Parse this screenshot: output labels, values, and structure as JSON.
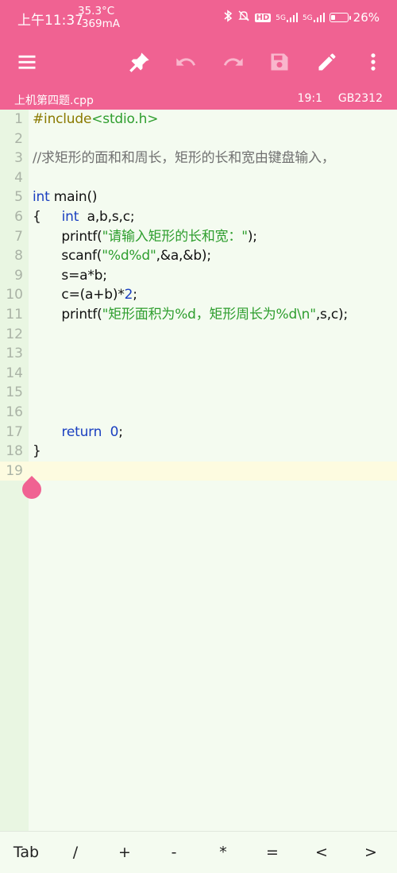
{
  "status_bar": {
    "time": "上午11:37",
    "temp": "35.3°C",
    "current": "-369mA",
    "net1": "5G",
    "net2": "5G",
    "hd": "HD",
    "battery_percent": "26%",
    "battery_level": 0.26
  },
  "toolbar": {
    "icons": [
      "menu-icon",
      "pin-icon",
      "undo-icon",
      "redo-icon",
      "save-icon",
      "edit-icon",
      "more-icon"
    ]
  },
  "info_bar": {
    "filename": "上机第四题.cpp",
    "position": "19:1",
    "encoding": "GB2312"
  },
  "editor": {
    "current_line": 19,
    "lines": [
      {
        "n": "1",
        "tokens": [
          {
            "t": "#include",
            "c": "pre"
          },
          {
            "t": "<stdio.h>",
            "c": "str"
          }
        ]
      },
      {
        "n": "2",
        "tokens": []
      },
      {
        "n": "3",
        "tokens": [
          {
            "t": "//求矩形的面和和周长，矩形的长和宽由键盘输入，",
            "c": "cmt"
          }
        ]
      },
      {
        "n": "4",
        "tokens": []
      },
      {
        "n": "5",
        "tokens": [
          {
            "t": "int",
            "c": "kw"
          },
          {
            "t": " main()",
            "c": ""
          }
        ]
      },
      {
        "n": "6",
        "tokens": [
          {
            "t": "{     ",
            "c": ""
          },
          {
            "t": "int",
            "c": "kw"
          },
          {
            "t": "  a,b,s,c;",
            "c": ""
          }
        ]
      },
      {
        "n": "7",
        "tokens": [
          {
            "t": "       printf(",
            "c": ""
          },
          {
            "t": "\"请输入矩形的长和宽：\"",
            "c": "str"
          },
          {
            "t": ");",
            "c": ""
          }
        ]
      },
      {
        "n": "8",
        "tokens": [
          {
            "t": "       scanf(",
            "c": ""
          },
          {
            "t": "\"%d%d\"",
            "c": "str"
          },
          {
            "t": ",&a,&b);",
            "c": ""
          }
        ]
      },
      {
        "n": "9",
        "tokens": [
          {
            "t": "       s=a*b;",
            "c": ""
          }
        ]
      },
      {
        "n": "10",
        "tokens": [
          {
            "t": "       c=(a+b)*",
            "c": ""
          },
          {
            "t": "2",
            "c": "num"
          },
          {
            "t": ";",
            "c": ""
          }
        ]
      },
      {
        "n": "11",
        "tokens": [
          {
            "t": "       printf(",
            "c": ""
          },
          {
            "t": "\"矩形面积为%d，矩形周长为%d\\n\"",
            "c": "str"
          },
          {
            "t": ",s,c);",
            "c": ""
          }
        ]
      },
      {
        "n": "12",
        "tokens": []
      },
      {
        "n": "13",
        "tokens": []
      },
      {
        "n": "14",
        "tokens": []
      },
      {
        "n": "15",
        "tokens": []
      },
      {
        "n": "16",
        "tokens": []
      },
      {
        "n": "17",
        "tokens": [
          {
            "t": "       ",
            "c": ""
          },
          {
            "t": "return",
            "c": "kw"
          },
          {
            "t": "  ",
            "c": ""
          },
          {
            "t": "0",
            "c": "num"
          },
          {
            "t": ";",
            "c": ""
          }
        ]
      },
      {
        "n": "18",
        "tokens": [
          {
            "t": "}",
            "c": ""
          }
        ]
      },
      {
        "n": "19",
        "tokens": []
      }
    ]
  },
  "key_bar": {
    "keys": [
      "Tab",
      "/",
      "+",
      "-",
      "*",
      "=",
      "<",
      ">"
    ]
  }
}
